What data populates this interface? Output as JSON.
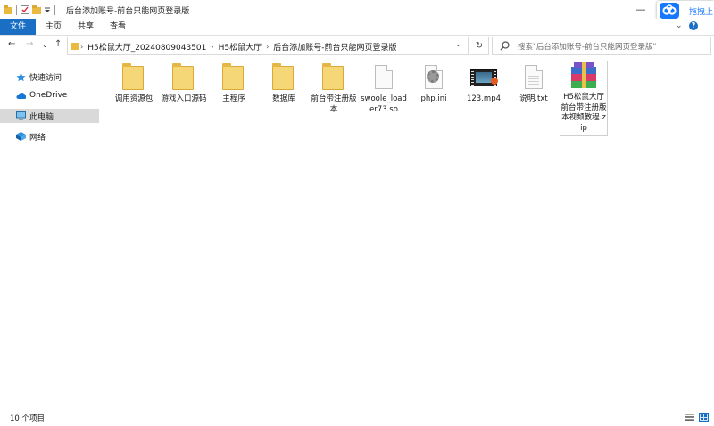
{
  "window": {
    "title": "后台添加账号-前台只能网页登录版",
    "minimize": "—",
    "maximize": "☐",
    "close": "✕"
  },
  "baidu_badge": {
    "label": "拖拽上"
  },
  "ribbon": {
    "tabs": [
      "文件",
      "主页",
      "共享",
      "查看"
    ],
    "help": "?"
  },
  "nav": {
    "breadcrumbs": [
      "H5松鼠大厅_20240809043501",
      "H5松鼠大厅",
      "后台添加账号-前台只能网页登录版"
    ],
    "search_placeholder": "搜索\"后台添加账号-前台只能网页登录版\""
  },
  "sidebar": {
    "items": [
      {
        "label": "快速访问",
        "icon": "star-icon"
      },
      {
        "label": "OneDrive",
        "icon": "cloud-icon"
      },
      {
        "label": "此电脑",
        "icon": "computer-icon",
        "selected": true
      },
      {
        "label": "网络",
        "icon": "network-icon"
      }
    ]
  },
  "files": [
    {
      "name": "调用资源包",
      "type": "folder"
    },
    {
      "name": "游戏入口源码",
      "type": "folder"
    },
    {
      "name": "主程序",
      "type": "folder"
    },
    {
      "name": "数据库",
      "type": "folder"
    },
    {
      "name": "前台带注册版本",
      "type": "folder"
    },
    {
      "name": "swoole_loader73.so",
      "type": "file"
    },
    {
      "name": "php.ini",
      "type": "settings"
    },
    {
      "name": "123.mp4",
      "type": "video"
    },
    {
      "name": "说明.txt",
      "type": "text"
    },
    {
      "name": "H5松鼠大厅前台带注册版本视频教程.zip",
      "type": "archive",
      "selected": true
    }
  ],
  "status": {
    "count_text": "10 个项目"
  },
  "colors": {
    "accent": "#1a6fc4",
    "folder": "#f6d778",
    "baidu": "#1677ff",
    "selection": "#d9d9d9"
  }
}
